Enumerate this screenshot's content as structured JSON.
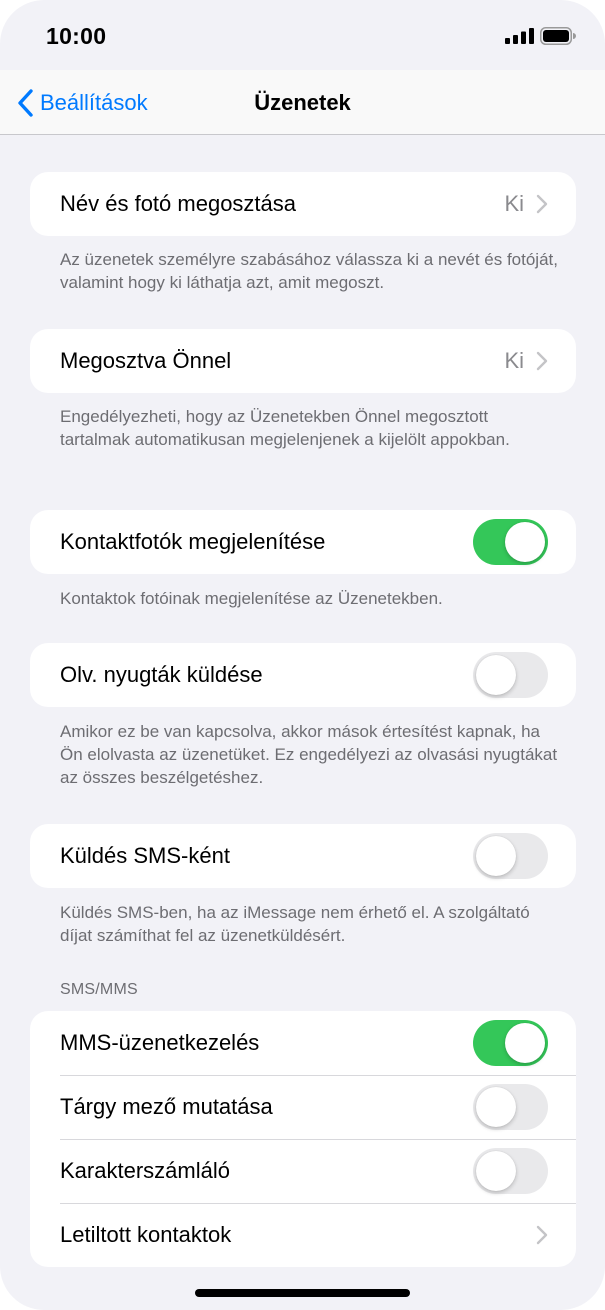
{
  "status_bar": {
    "time": "10:00"
  },
  "nav": {
    "back_label": "Beállítások",
    "title": "Üzenetek"
  },
  "groups": {
    "share_name": {
      "label": "Név és fotó megosztása",
      "value": "Ki",
      "footer": "Az üzenetek személyre szabásához válassza ki a nevét és fotóját, valamint hogy ki láthatja azt, amit megoszt."
    },
    "shared_with_you": {
      "label": "Megosztva Önnel",
      "value": "Ki",
      "footer": "Engedélyezheti, hogy az Üzenetekben Önnel megosztott tartalmak automatikusan megjelenjenek a kijelölt appokban."
    },
    "contact_photos": {
      "label": "Kontaktfotók megjelenítése",
      "toggle": true,
      "footer": "Kontaktok fotóinak megjelenítése az Üzenetekben."
    },
    "read_receipts": {
      "label": "Olv. nyugták küldése",
      "toggle": false,
      "footer": "Amikor ez be van kapcsolva, akkor mások értesítést kapnak, ha Ön elolvasta az üzenetüket. Ez engedélyezi az olvasási nyugtákat az összes beszélgetéshez."
    },
    "send_as_sms": {
      "label": "Küldés SMS-ként",
      "toggle": false,
      "footer": "Küldés SMS-ben, ha az iMessage nem érhető el. A szolgáltató díjat számíthat fel az üzenetküldésért."
    }
  },
  "sms_mms": {
    "header": "SMS/MMS",
    "rows": [
      {
        "label": "MMS-üzenetkezelés",
        "toggle": true
      },
      {
        "label": "Tárgy mező mutatása",
        "toggle": false
      },
      {
        "label": "Karakterszámláló",
        "toggle": false
      },
      {
        "label": "Letiltott kontaktok"
      }
    ]
  },
  "colors": {
    "accent": "#007aff",
    "toggle_on": "#34c759",
    "background": "#f2f2f7"
  }
}
